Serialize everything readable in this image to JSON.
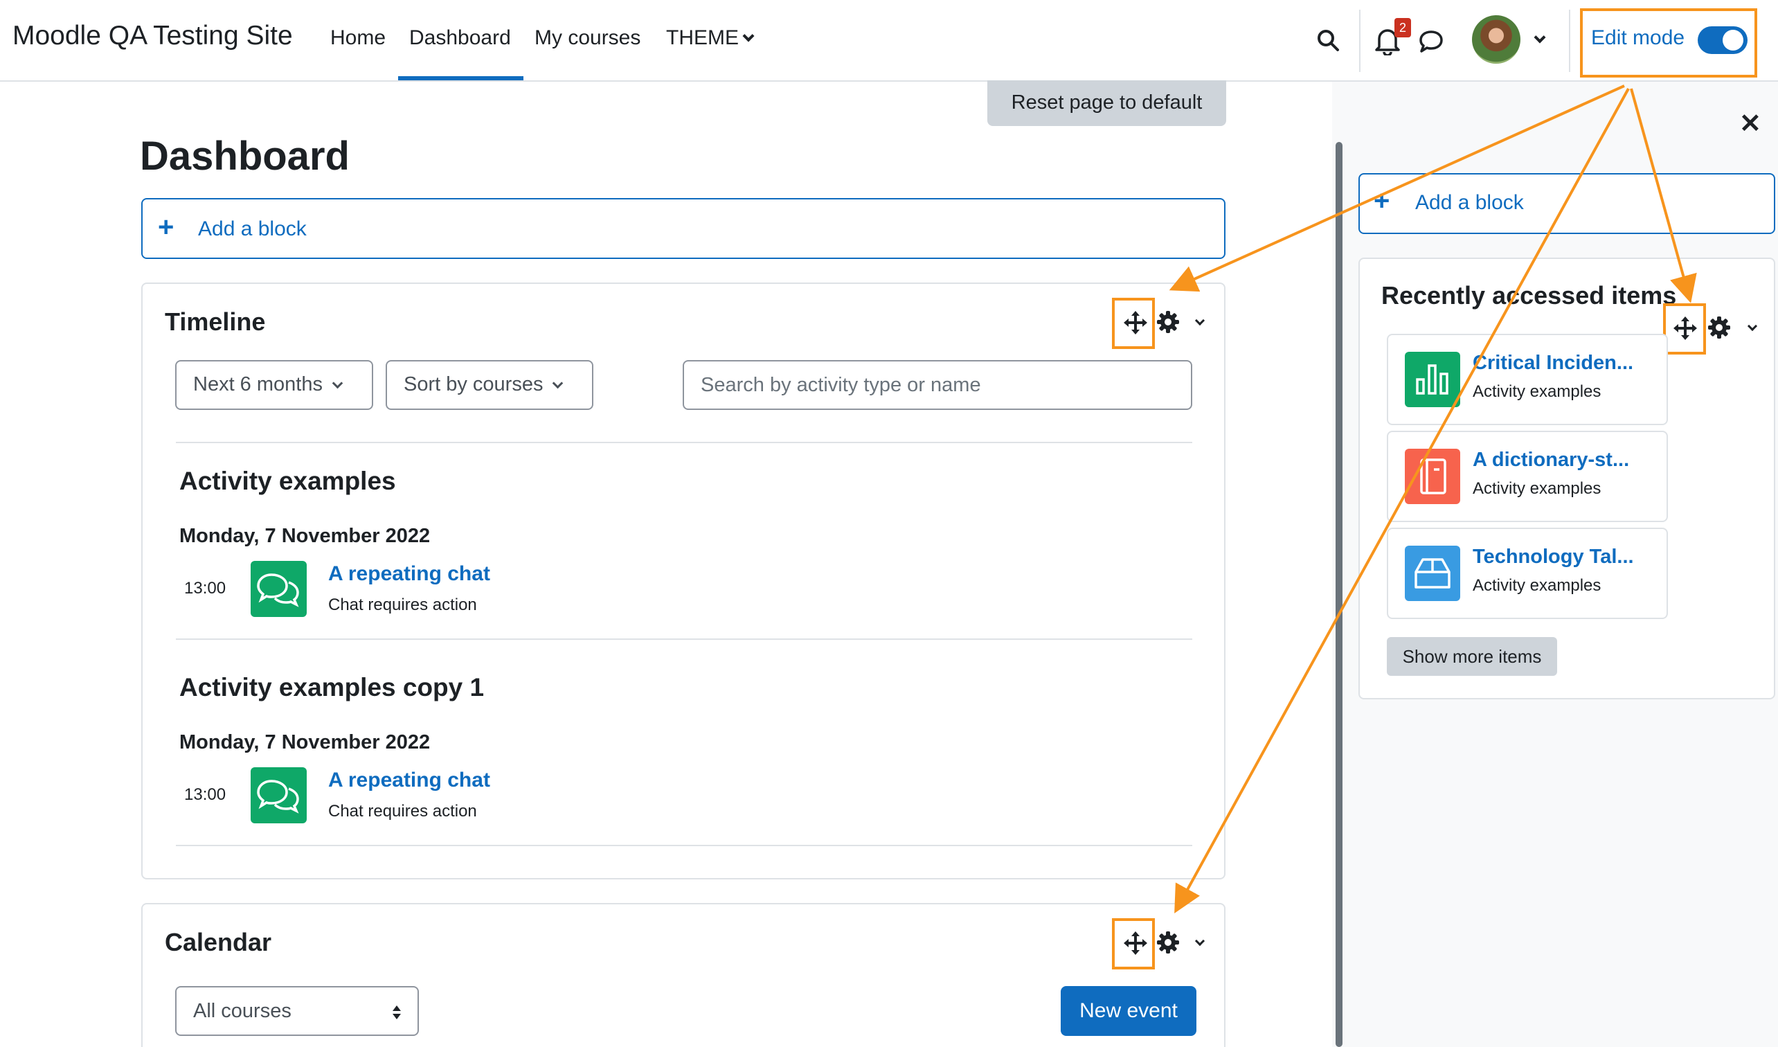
{
  "navbar": {
    "site_name": "Moodle QA Testing Site",
    "links": [
      "Home",
      "Dashboard",
      "My courses",
      "THEME"
    ],
    "notification_count": "2",
    "edit_mode_label": "Edit mode",
    "edit_mode_on": true
  },
  "main": {
    "reset_label": "Reset page to default",
    "title": "Dashboard",
    "add_block_label": "Add a block",
    "timeline": {
      "title": "Timeline",
      "filter_range": "Next 6 months",
      "sort": "Sort by courses",
      "search_placeholder": "Search by activity type or name",
      "groups": [
        {
          "course": "Activity examples",
          "date": "Monday, 7 November 2022",
          "time": "13:00",
          "activity": "A repeating chat",
          "status": "Chat requires action"
        },
        {
          "course": "Activity examples copy 1",
          "date": "Monday, 7 November 2022",
          "time": "13:00",
          "activity": "A repeating chat",
          "status": "Chat requires action"
        }
      ]
    },
    "calendar": {
      "title": "Calendar",
      "course_filter": "All courses",
      "new_event_label": "New event"
    }
  },
  "drawer": {
    "add_block_label": "Add a block",
    "recent": {
      "title": "Recently accessed items",
      "items": [
        {
          "title": "Critical Inciden...",
          "course": "Activity examples",
          "icon": "feedback-icon",
          "color": "#0fa868"
        },
        {
          "title": "A dictionary-st...",
          "course": "Activity examples",
          "icon": "book-icon",
          "color": "#f7634d"
        },
        {
          "title": "Technology Tal...",
          "course": "Activity examples",
          "icon": "box-icon",
          "color": "#399be2"
        }
      ],
      "show_more_label": "Show more items"
    }
  },
  "colors": {
    "brand": "#0f6cbf",
    "highlight": "#f7941d",
    "badge": "#ca3120"
  }
}
